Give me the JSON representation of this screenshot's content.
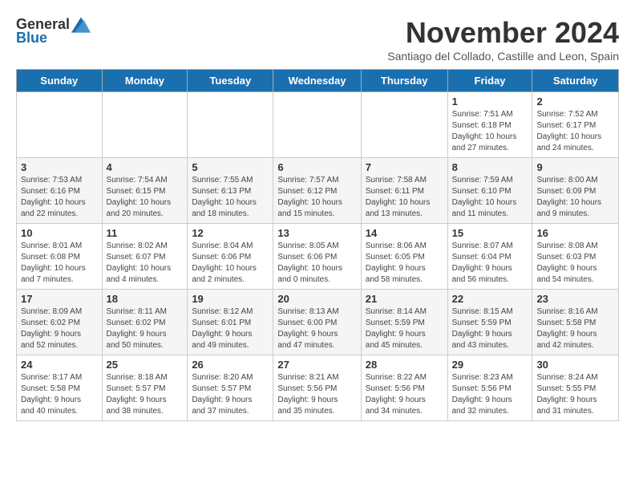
{
  "logo": {
    "general": "General",
    "blue": "Blue"
  },
  "title": "November 2024",
  "subtitle": "Santiago del Collado, Castille and Leon, Spain",
  "days_of_week": [
    "Sunday",
    "Monday",
    "Tuesday",
    "Wednesday",
    "Thursday",
    "Friday",
    "Saturday"
  ],
  "weeks": [
    [
      {
        "day": "",
        "info": ""
      },
      {
        "day": "",
        "info": ""
      },
      {
        "day": "",
        "info": ""
      },
      {
        "day": "",
        "info": ""
      },
      {
        "day": "",
        "info": ""
      },
      {
        "day": "1",
        "info": "Sunrise: 7:51 AM\nSunset: 6:18 PM\nDaylight: 10 hours\nand 27 minutes."
      },
      {
        "day": "2",
        "info": "Sunrise: 7:52 AM\nSunset: 6:17 PM\nDaylight: 10 hours\nand 24 minutes."
      }
    ],
    [
      {
        "day": "3",
        "info": "Sunrise: 7:53 AM\nSunset: 6:16 PM\nDaylight: 10 hours\nand 22 minutes."
      },
      {
        "day": "4",
        "info": "Sunrise: 7:54 AM\nSunset: 6:15 PM\nDaylight: 10 hours\nand 20 minutes."
      },
      {
        "day": "5",
        "info": "Sunrise: 7:55 AM\nSunset: 6:13 PM\nDaylight: 10 hours\nand 18 minutes."
      },
      {
        "day": "6",
        "info": "Sunrise: 7:57 AM\nSunset: 6:12 PM\nDaylight: 10 hours\nand 15 minutes."
      },
      {
        "day": "7",
        "info": "Sunrise: 7:58 AM\nSunset: 6:11 PM\nDaylight: 10 hours\nand 13 minutes."
      },
      {
        "day": "8",
        "info": "Sunrise: 7:59 AM\nSunset: 6:10 PM\nDaylight: 10 hours\nand 11 minutes."
      },
      {
        "day": "9",
        "info": "Sunrise: 8:00 AM\nSunset: 6:09 PM\nDaylight: 10 hours\nand 9 minutes."
      }
    ],
    [
      {
        "day": "10",
        "info": "Sunrise: 8:01 AM\nSunset: 6:08 PM\nDaylight: 10 hours\nand 7 minutes."
      },
      {
        "day": "11",
        "info": "Sunrise: 8:02 AM\nSunset: 6:07 PM\nDaylight: 10 hours\nand 4 minutes."
      },
      {
        "day": "12",
        "info": "Sunrise: 8:04 AM\nSunset: 6:06 PM\nDaylight: 10 hours\nand 2 minutes."
      },
      {
        "day": "13",
        "info": "Sunrise: 8:05 AM\nSunset: 6:06 PM\nDaylight: 10 hours\nand 0 minutes."
      },
      {
        "day": "14",
        "info": "Sunrise: 8:06 AM\nSunset: 6:05 PM\nDaylight: 9 hours\nand 58 minutes."
      },
      {
        "day": "15",
        "info": "Sunrise: 8:07 AM\nSunset: 6:04 PM\nDaylight: 9 hours\nand 56 minutes."
      },
      {
        "day": "16",
        "info": "Sunrise: 8:08 AM\nSunset: 6:03 PM\nDaylight: 9 hours\nand 54 minutes."
      }
    ],
    [
      {
        "day": "17",
        "info": "Sunrise: 8:09 AM\nSunset: 6:02 PM\nDaylight: 9 hours\nand 52 minutes."
      },
      {
        "day": "18",
        "info": "Sunrise: 8:11 AM\nSunset: 6:02 PM\nDaylight: 9 hours\nand 50 minutes."
      },
      {
        "day": "19",
        "info": "Sunrise: 8:12 AM\nSunset: 6:01 PM\nDaylight: 9 hours\nand 49 minutes."
      },
      {
        "day": "20",
        "info": "Sunrise: 8:13 AM\nSunset: 6:00 PM\nDaylight: 9 hours\nand 47 minutes."
      },
      {
        "day": "21",
        "info": "Sunrise: 8:14 AM\nSunset: 5:59 PM\nDaylight: 9 hours\nand 45 minutes."
      },
      {
        "day": "22",
        "info": "Sunrise: 8:15 AM\nSunset: 5:59 PM\nDaylight: 9 hours\nand 43 minutes."
      },
      {
        "day": "23",
        "info": "Sunrise: 8:16 AM\nSunset: 5:58 PM\nDaylight: 9 hours\nand 42 minutes."
      }
    ],
    [
      {
        "day": "24",
        "info": "Sunrise: 8:17 AM\nSunset: 5:58 PM\nDaylight: 9 hours\nand 40 minutes."
      },
      {
        "day": "25",
        "info": "Sunrise: 8:18 AM\nSunset: 5:57 PM\nDaylight: 9 hours\nand 38 minutes."
      },
      {
        "day": "26",
        "info": "Sunrise: 8:20 AM\nSunset: 5:57 PM\nDaylight: 9 hours\nand 37 minutes."
      },
      {
        "day": "27",
        "info": "Sunrise: 8:21 AM\nSunset: 5:56 PM\nDaylight: 9 hours\nand 35 minutes."
      },
      {
        "day": "28",
        "info": "Sunrise: 8:22 AM\nSunset: 5:56 PM\nDaylight: 9 hours\nand 34 minutes."
      },
      {
        "day": "29",
        "info": "Sunrise: 8:23 AM\nSunset: 5:56 PM\nDaylight: 9 hours\nand 32 minutes."
      },
      {
        "day": "30",
        "info": "Sunrise: 8:24 AM\nSunset: 5:55 PM\nDaylight: 9 hours\nand 31 minutes."
      }
    ]
  ]
}
